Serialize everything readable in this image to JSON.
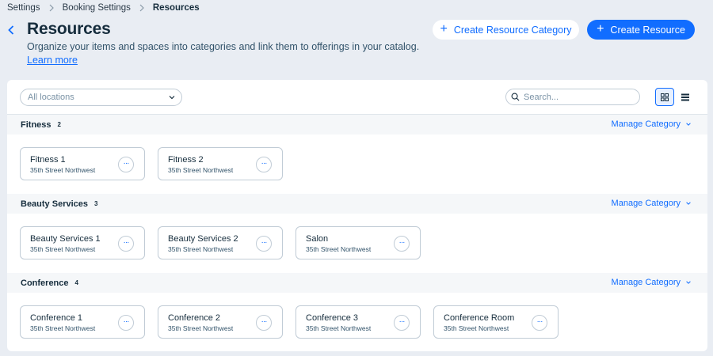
{
  "breadcrumb": [
    "Settings",
    "Booking Settings",
    "Resources"
  ],
  "header": {
    "title": "Resources",
    "subtitle": "Organize your items and spaces into categories and link them to offerings in your catalog.",
    "learn_more": "Learn more",
    "create_category_label": "Create Resource Category",
    "create_resource_label": "Create Resource"
  },
  "toolbar": {
    "location_filter": "All locations",
    "search_placeholder": "Search..."
  },
  "manage_label": "Manage Category",
  "categories": [
    {
      "name": "Fitness",
      "count": "2",
      "resources": [
        {
          "title": "Fitness 1",
          "location": "35th Street Northwest"
        },
        {
          "title": "Fitness 2",
          "location": "35th Street Northwest"
        }
      ]
    },
    {
      "name": "Beauty Services",
      "count": "3",
      "resources": [
        {
          "title": "Beauty Services 1",
          "location": "35th Street Northwest"
        },
        {
          "title": "Beauty Services 2",
          "location": "35th Street Northwest"
        },
        {
          "title": "Salon",
          "location": "35th Street Northwest"
        }
      ]
    },
    {
      "name": "Conference",
      "count": "4",
      "resources": [
        {
          "title": "Conference 1",
          "location": "35th Street Northwest"
        },
        {
          "title": "Conference 2",
          "location": "35th Street Northwest"
        },
        {
          "title": "Conference 3",
          "location": "35th Street Northwest"
        },
        {
          "title": "Conference Room",
          "location": "35th Street Northwest"
        }
      ]
    }
  ],
  "colors": {
    "accent": "#116dff",
    "page_bg": "#e9edf3",
    "text": "#162d3d"
  }
}
